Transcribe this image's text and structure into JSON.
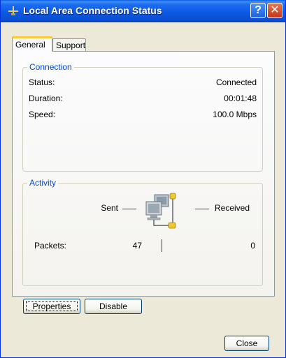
{
  "window": {
    "title": "Local Area Connection Status",
    "help_button": "?",
    "close_button": "✕"
  },
  "tabs": [
    {
      "label": "General",
      "active": true
    },
    {
      "label": "Support",
      "active": false
    }
  ],
  "connection": {
    "legend": "Connection",
    "rows": [
      {
        "label": "Status:",
        "value": "Connected"
      },
      {
        "label": "Duration:",
        "value": "00:01:48"
      },
      {
        "label": "Speed:",
        "value": "100.0 Mbps"
      }
    ]
  },
  "activity": {
    "legend": "Activity",
    "sent_label": "Sent",
    "received_label": "Received",
    "packets_label": "Packets:",
    "packets_sent": "47",
    "packets_received": "0",
    "icon": "network-computers-icon"
  },
  "buttons": {
    "properties": "Properties",
    "disable": "Disable",
    "close": "Close"
  },
  "colors": {
    "titlebar": "#0a58e0",
    "group_legend": "#0046d5",
    "dialog_background": "#ece9d8",
    "active_tab_highlight": "#ffc83c"
  }
}
